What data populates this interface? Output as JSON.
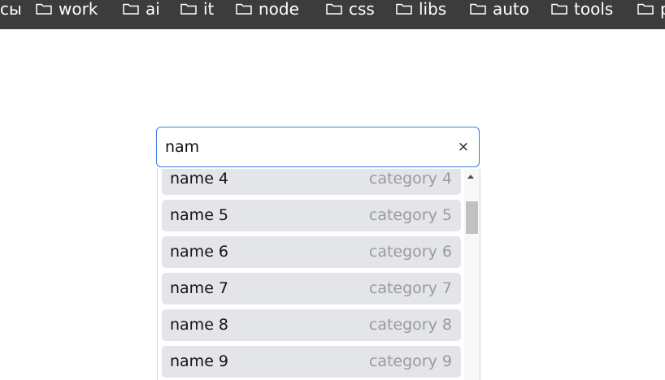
{
  "bookmarks": {
    "partial_label": "сы",
    "items": [
      "work",
      "ai",
      "it",
      "node",
      "css",
      "libs",
      "auto",
      "tools",
      "р"
    ]
  },
  "search": {
    "value": "nam",
    "clear_label": "×"
  },
  "results": [
    {
      "name": "name 4",
      "category": "category 4"
    },
    {
      "name": "name 5",
      "category": "category 5"
    },
    {
      "name": "name 6",
      "category": "category 6"
    },
    {
      "name": "name 7",
      "category": "category 7"
    },
    {
      "name": "name 8",
      "category": "category 8"
    },
    {
      "name": "name 9",
      "category": "category 9"
    }
  ],
  "icons": {
    "bookmark_folder": "folder-icon",
    "scroll_up": "triangle-up-icon"
  }
}
